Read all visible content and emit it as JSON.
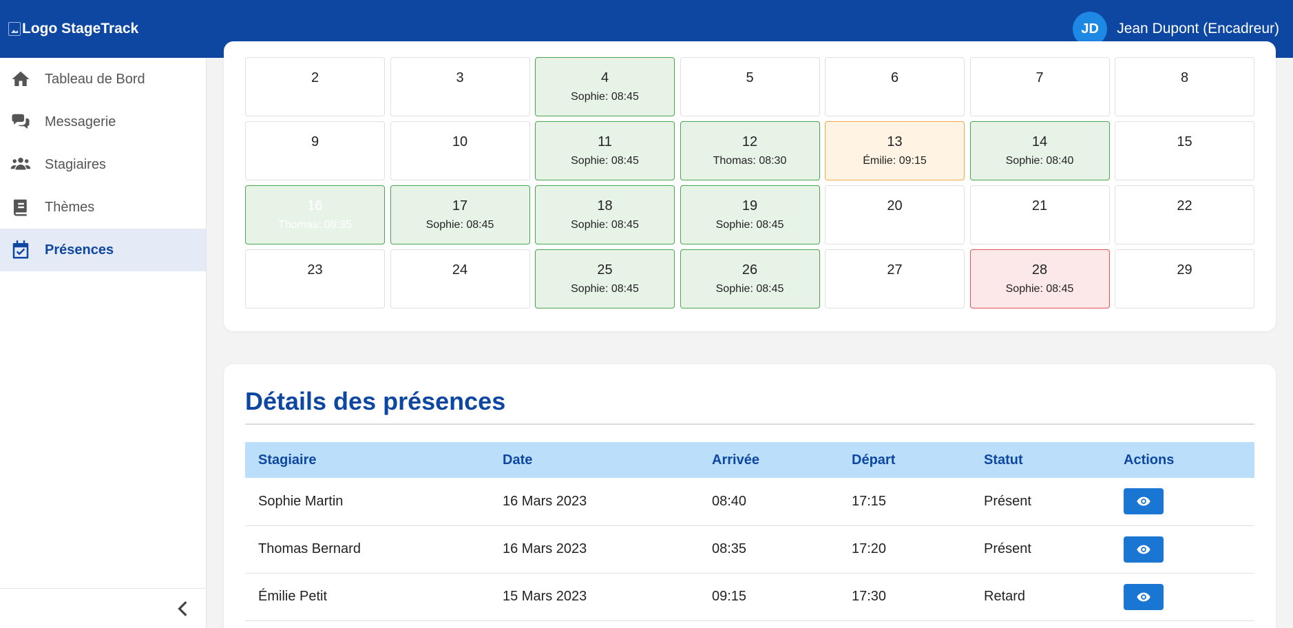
{
  "header": {
    "logo_alt": "Logo StageTrack",
    "avatar_initials": "JD",
    "user_name": "Jean Dupont (Encadreur)"
  },
  "sidebar": {
    "items": [
      {
        "label": "Tableau de Bord",
        "icon": "home-icon"
      },
      {
        "label": "Messagerie",
        "icon": "chat-icon"
      },
      {
        "label": "Stagiaires",
        "icon": "users-icon"
      },
      {
        "label": "Thèmes",
        "icon": "book-icon"
      },
      {
        "label": "Présences",
        "icon": "calendar-check-icon",
        "active": true
      }
    ],
    "collapse_icon": "chevron-left-icon"
  },
  "calendar": {
    "days": [
      {
        "day": "2",
        "info": "",
        "status": "none"
      },
      {
        "day": "3",
        "info": "",
        "status": "none"
      },
      {
        "day": "4",
        "info": "Sophie: 08:45",
        "status": "present"
      },
      {
        "day": "5",
        "info": "",
        "status": "none"
      },
      {
        "day": "6",
        "info": "",
        "status": "none"
      },
      {
        "day": "7",
        "info": "",
        "status": "none"
      },
      {
        "day": "8",
        "info": "",
        "status": "none"
      },
      {
        "day": "9",
        "info": "",
        "status": "none"
      },
      {
        "day": "10",
        "info": "",
        "status": "none"
      },
      {
        "day": "11",
        "info": "Sophie: 08:45",
        "status": "present"
      },
      {
        "day": "12",
        "info": "Thomas: 08:30",
        "status": "present"
      },
      {
        "day": "13",
        "info": "Émilie: 09:15",
        "status": "late"
      },
      {
        "day": "14",
        "info": "Sophie: 08:40",
        "status": "present"
      },
      {
        "day": "15",
        "info": "",
        "status": "none"
      },
      {
        "day": "16",
        "info": "Thomas: 08:35",
        "status": "present",
        "selected": true
      },
      {
        "day": "17",
        "info": "Sophie: 08:45",
        "status": "present"
      },
      {
        "day": "18",
        "info": "Sophie: 08:45",
        "status": "present"
      },
      {
        "day": "19",
        "info": "Sophie: 08:45",
        "status": "present"
      },
      {
        "day": "20",
        "info": "",
        "status": "none"
      },
      {
        "day": "21",
        "info": "",
        "status": "none"
      },
      {
        "day": "22",
        "info": "",
        "status": "none"
      },
      {
        "day": "23",
        "info": "",
        "status": "none"
      },
      {
        "day": "24",
        "info": "",
        "status": "none"
      },
      {
        "day": "25",
        "info": "Sophie: 08:45",
        "status": "present"
      },
      {
        "day": "26",
        "info": "Sophie: 08:45",
        "status": "present"
      },
      {
        "day": "27",
        "info": "",
        "status": "none"
      },
      {
        "day": "28",
        "info": "Sophie: 08:45",
        "status": "absent"
      },
      {
        "day": "29",
        "info": "",
        "status": "none"
      }
    ]
  },
  "details": {
    "title": "Détails des présences",
    "columns": [
      "Stagiaire",
      "Date",
      "Arrivée",
      "Départ",
      "Statut",
      "Actions"
    ],
    "rows": [
      {
        "stagiaire": "Sophie Martin",
        "date": "16 Mars 2023",
        "arrivee": "08:40",
        "depart": "17:15",
        "statut": "Présent",
        "action_icon": "eye-icon"
      },
      {
        "stagiaire": "Thomas Bernard",
        "date": "16 Mars 2023",
        "arrivee": "08:35",
        "depart": "17:20",
        "statut": "Présent",
        "action_icon": "eye-icon"
      },
      {
        "stagiaire": "Émilie Petit",
        "date": "15 Mars 2023",
        "arrivee": "09:15",
        "depart": "17:30",
        "statut": "Retard",
        "action_icon": "eye-icon"
      }
    ]
  },
  "colors": {
    "header": "#0d47a1",
    "present": "#e8f3e8",
    "late": "#fff3e3",
    "absent": "#fce8e8",
    "table_header": "#bbdefb",
    "action_button": "#1976d2"
  }
}
